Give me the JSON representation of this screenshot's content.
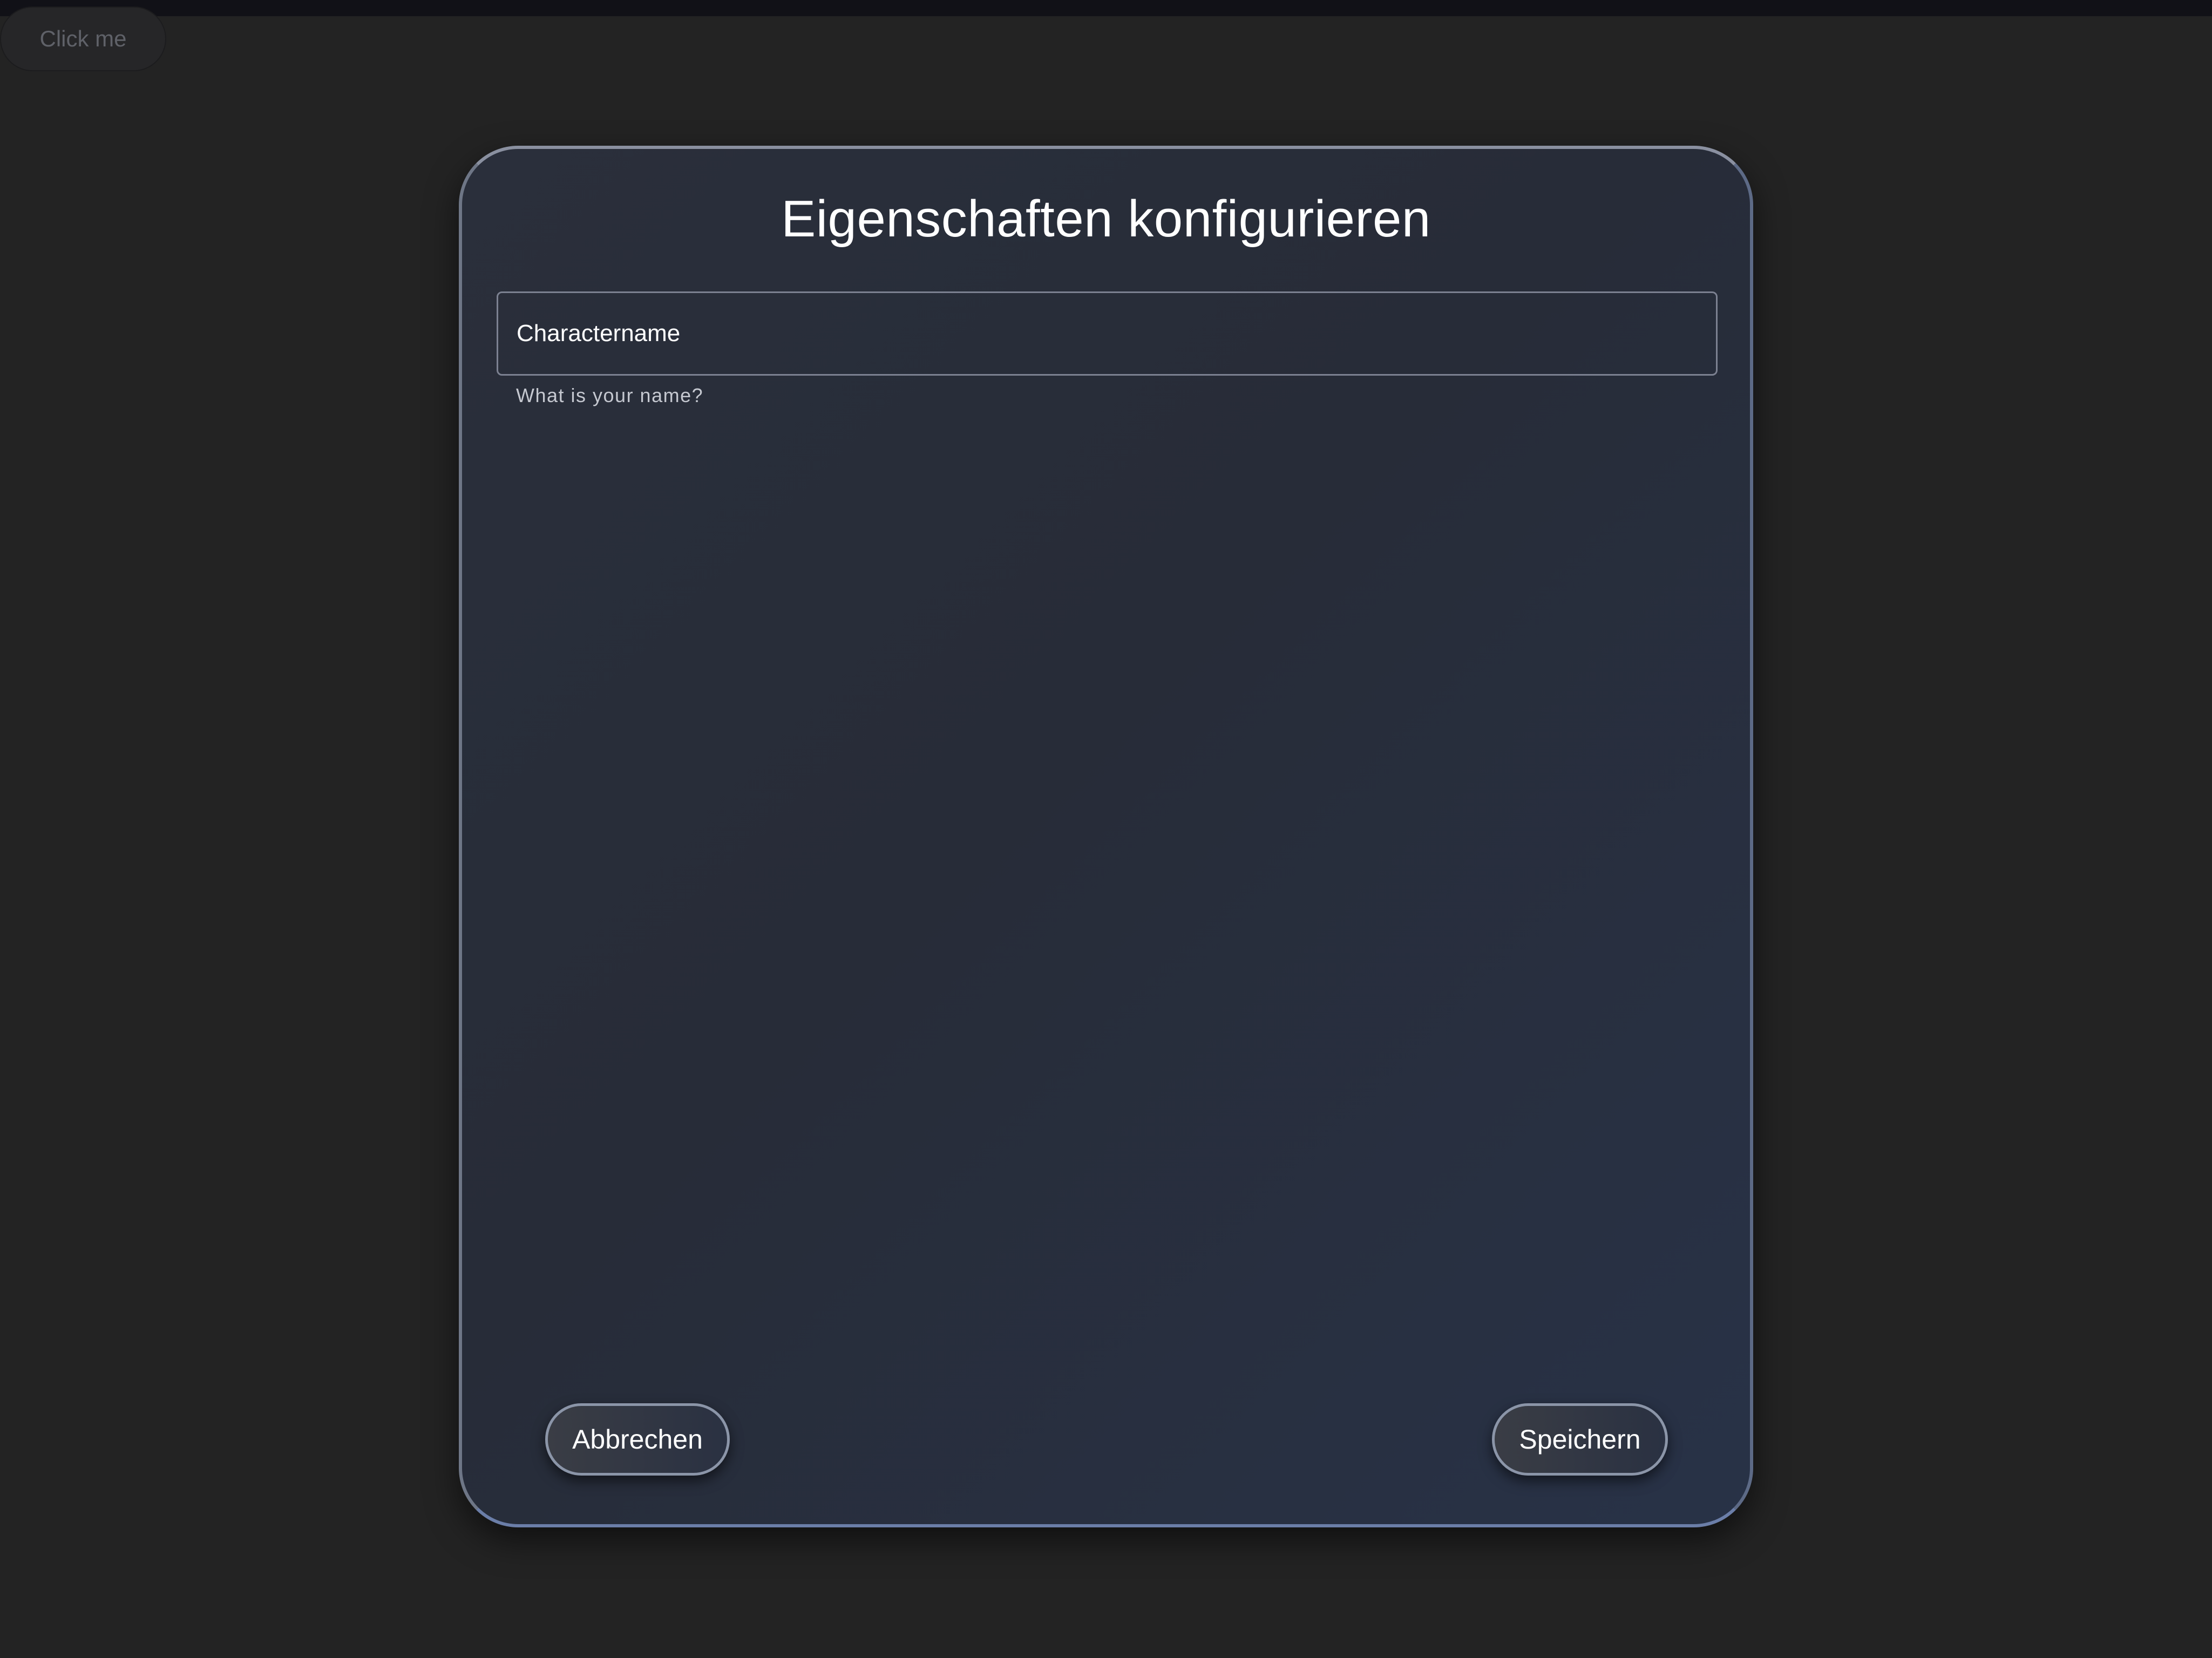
{
  "top_button": {
    "label": "Click me"
  },
  "dialog": {
    "title": "Eigenschaften konfigurieren",
    "field": {
      "value": "Charactername",
      "hint": "What is your name?"
    },
    "cancel_label": "Abbrechen",
    "save_label": "Speichern"
  }
}
